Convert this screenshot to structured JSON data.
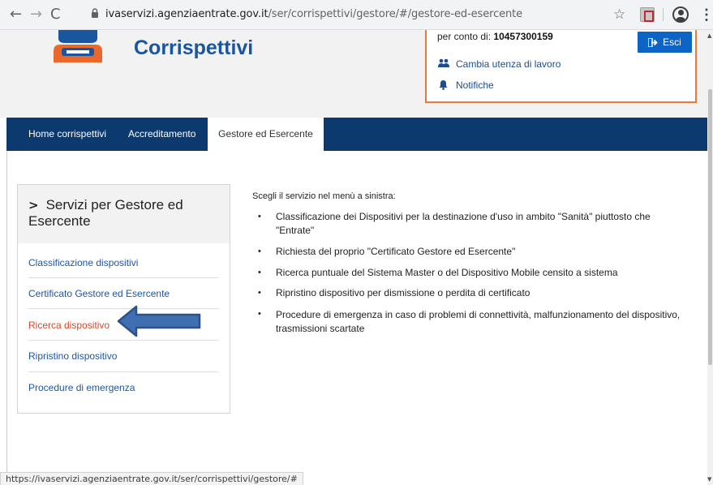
{
  "browser": {
    "url_host": "ivaservizi.agenziaentrate.gov.it",
    "url_path": "/ser/corrispettivi/gestore/#/gestore-ed-esercente",
    "status_url": "https://ivaservizi.agenziaentrate.gov.it/ser/corrispettivi/gestore/#"
  },
  "header": {
    "app_title": "Corrispettivi"
  },
  "user_box": {
    "conto_label": "per conto di:",
    "conto_value": "10457300159",
    "esci_label": "Esci",
    "cambia_label": "Cambia utenza di lavoro",
    "notifiche_label": "Notifiche"
  },
  "nav": {
    "items": [
      {
        "label": "Home corrispettivi"
      },
      {
        "label": "Accreditamento"
      },
      {
        "label": "Gestore ed Esercente"
      }
    ]
  },
  "sidebar": {
    "title": "Servizi per Gestore ed Esercente",
    "items": [
      {
        "label": "Classificazione dispositivi"
      },
      {
        "label": "Certificato Gestore ed Esercente"
      },
      {
        "label": "Ricerca dispositivo"
      },
      {
        "label": "Ripristino dispositivo"
      },
      {
        "label": "Procedure di emergenza"
      }
    ]
  },
  "main": {
    "intro": "Scegli il servizio nel menù a sinistra:",
    "bullets": [
      "Classificazione dei Dispositivi per la destinazione d'uso in ambito \"Sanità\" piuttosto che \"Entrate\"",
      "Richiesta del proprio \"Certificato Gestore ed Esercente\"",
      "Ricerca puntuale del Sistema Master o del Dispositivo Mobile censito a sistema",
      "Ripristino dispositivo per dismissione o perdita di certificato",
      "Procedure di emergenza in caso di problemi di connettività, malfunzionamento del dispositivo, trasmissioni scartate"
    ]
  },
  "colors": {
    "nav_bg": "#0c3a6e",
    "accent_blue": "#0d64c4",
    "title_blue": "#1a56a0",
    "active_orange": "#d9482a",
    "box_border": "#ea7a3a"
  }
}
